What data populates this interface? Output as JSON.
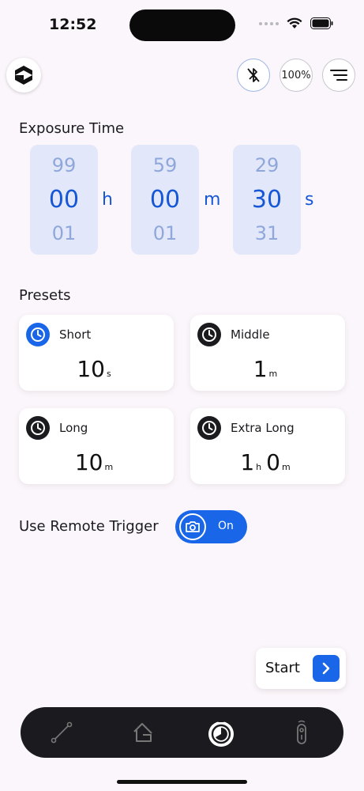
{
  "status": {
    "time": "12:52"
  },
  "header": {
    "logo_icon": "app-logo-icon",
    "bluetooth_icon": "bluetooth-off-icon",
    "battery": "100%",
    "menu_icon": "menu-icon"
  },
  "exposure": {
    "title": "Exposure Time",
    "hours": {
      "prev": "99",
      "current": "00",
      "next": "01",
      "unit": "h"
    },
    "minutes": {
      "prev": "59",
      "current": "00",
      "next": "01",
      "unit": "m"
    },
    "seconds": {
      "prev": "29",
      "current": "30",
      "next": "31",
      "unit": "s"
    }
  },
  "presets": {
    "title": "Presets",
    "items": [
      {
        "name": "Short",
        "value1": "10",
        "unit1": "s",
        "active": true
      },
      {
        "name": "Middle",
        "value1": "1",
        "unit1": "m",
        "active": false
      },
      {
        "name": "Long",
        "value1": "10",
        "unit1": "m",
        "active": false
      },
      {
        "name": "Extra Long",
        "value1": "1",
        "unit1": "h",
        "value2": "0",
        "unit2": "m",
        "active": false
      }
    ]
  },
  "remote_trigger": {
    "label": "Use Remote Trigger",
    "state": "On"
  },
  "start": {
    "label": "Start"
  },
  "nav": {
    "items": [
      {
        "icon": "intervalometer-icon"
      },
      {
        "icon": "home-icon"
      },
      {
        "icon": "timer-icon"
      },
      {
        "icon": "remote-icon"
      }
    ]
  },
  "colors": {
    "accent": "#1a66e8",
    "picker_bg": "#e2e8f9",
    "nav_bg": "#1b1b1f"
  }
}
